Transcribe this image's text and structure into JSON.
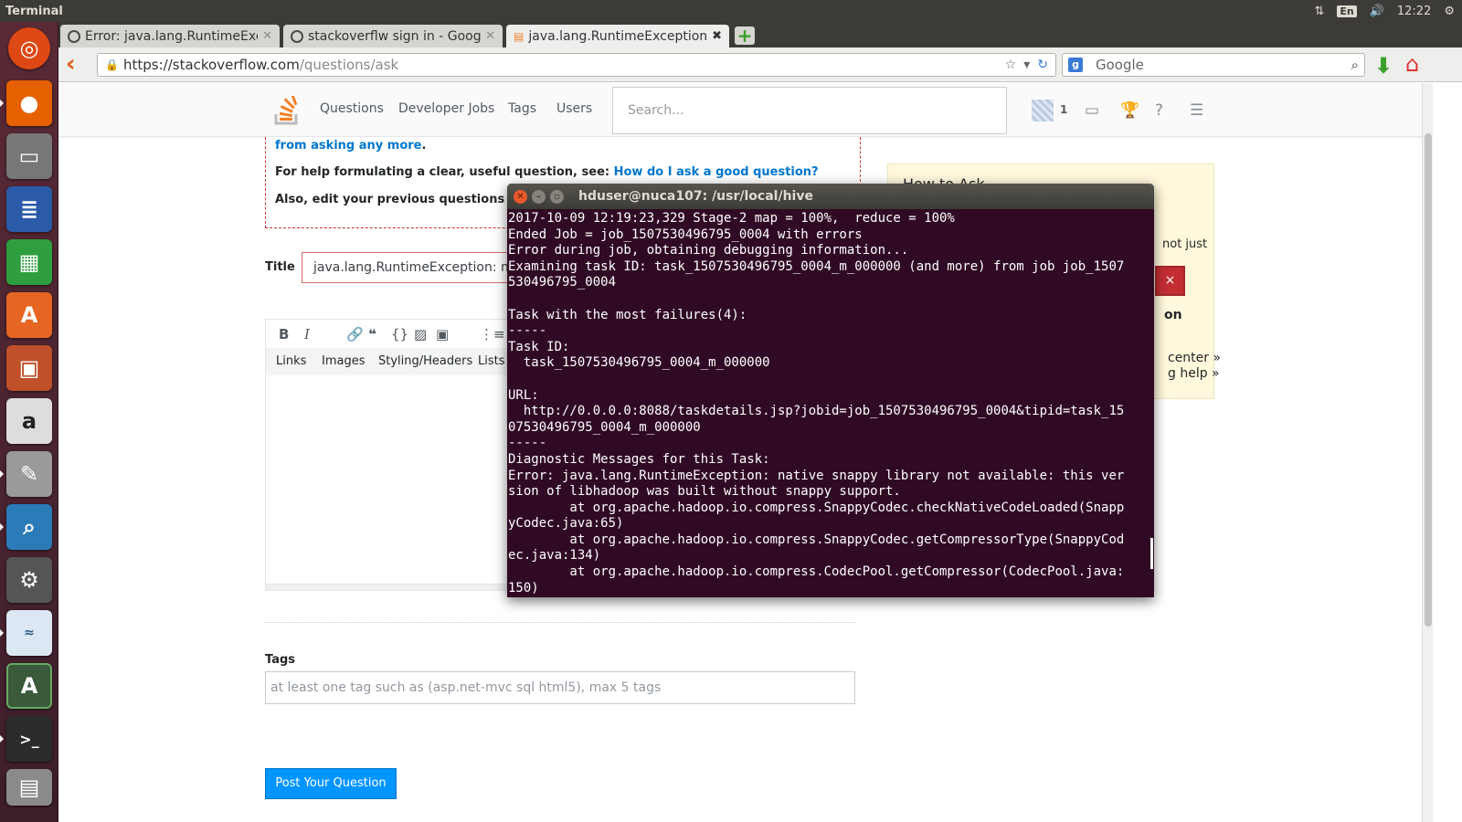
{
  "panel": {
    "app_title": "Terminal",
    "lang": "En",
    "time": "12:22"
  },
  "browser": {
    "tabs": [
      {
        "label": "Error: java.lang.RuntimeExc..."
      },
      {
        "label": "stackoverflw sign in - Googl..."
      },
      {
        "label": "java.lang.RuntimeException..."
      }
    ],
    "url_host": "https://stackoverflow.com",
    "url_path": "/questions/ask",
    "search_placeholder": "Google"
  },
  "so": {
    "nav": [
      "Questions",
      "Developer Jobs",
      "Tags",
      "Users"
    ],
    "search_placeholder": "Search...",
    "reputation": "1",
    "notice": {
      "line1_link": "from asking any more",
      "line2_text": "For help formulating a clear, useful question, see: ",
      "line2_link": "How do I ask a good question?",
      "line3": "Also, edit your previous questions to imp"
    },
    "title_label": "Title",
    "title_value": "java.lang.RuntimeException: nativ",
    "editor_tabs": [
      "Links",
      "Images",
      "Styling/Headers",
      "Lists"
    ],
    "tags_label": "Tags",
    "tags_placeholder": "at least one tag such as (asp.net-mvc sql html5), max 5 tags",
    "post_button": "Post Your Question",
    "sidebar": {
      "title": "How to Ask",
      "text1": "not just",
      "link1": "on",
      "link2": "center »",
      "link3": "g help »",
      "close": "×"
    }
  },
  "terminal": {
    "title": "hduser@nuca107: /usr/local/hive",
    "lines": [
      "2017-10-09 12:19:23,329 Stage-2 map = 100%,  reduce = 100%",
      "Ended Job = job_1507530496795_0004 with errors",
      "Error during job, obtaining debugging information...",
      "Examining task ID: task_1507530496795_0004_m_000000 (and more) from job job_1507",
      "530496795_0004",
      "",
      "Task with the most failures(4):",
      "-----",
      "Task ID:",
      "  task_1507530496795_0004_m_000000",
      "",
      "URL:",
      "  http://0.0.0.0:8088/taskdetails.jsp?jobid=job_1507530496795_0004&tipid=task_15",
      "07530496795_0004_m_000000",
      "-----",
      "Diagnostic Messages for this Task:",
      "Error: java.lang.RuntimeException: native snappy library not available: this ver",
      "sion of libhadoop was built without snappy support.",
      "        at org.apache.hadoop.io.compress.SnappyCodec.checkNativeCodeLoaded(Snapp",
      "yCodec.java:65)",
      "        at org.apache.hadoop.io.compress.SnappyCodec.getCompressorType(SnappyCod",
      "ec.java:134)",
      "        at org.apache.hadoop.io.compress.CodecPool.getCompressor(CodecPool.java:",
      "150)"
    ]
  }
}
